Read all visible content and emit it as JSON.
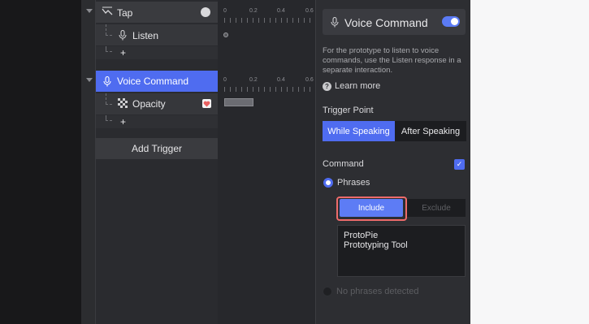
{
  "triggers": [
    {
      "name": "Tap",
      "icon": "tap-gesture-icon",
      "responses": [
        {
          "name": "Listen",
          "icon": "microphone-icon"
        }
      ]
    },
    {
      "name": "Voice Command",
      "icon": "microphone-icon",
      "selected": true,
      "responses": [
        {
          "name": "Opacity",
          "icon": "opacity-checker-icon"
        }
      ]
    }
  ],
  "add_symbol": "+",
  "add_trigger_label": "Add Trigger",
  "timeline": {
    "tick_labels": [
      "0",
      "0.2",
      "0.4",
      "0.6"
    ]
  },
  "panel": {
    "title": "Voice Command",
    "enabled": true,
    "description": "For the prototype to listen to voice commands, use the Listen response in a separate interaction.",
    "learn_more": "Learn more",
    "trigger_point_label": "Trigger Point",
    "trigger_point_options": [
      "While Speaking",
      "After Speaking"
    ],
    "trigger_point_selected": "While Speaking",
    "command_label": "Command",
    "command_checked": true,
    "phrases_label": "Phrases",
    "include_label": "Include",
    "exclude_label": "Exclude",
    "phrases": [
      "ProtoPie",
      "Prototyping Tool"
    ],
    "no_phrases_label": "No phrases detected"
  },
  "colors": {
    "accent": "#4f6cf0",
    "highlight_border": "#ee6b6b",
    "opacity_badge": "#f08a8a"
  }
}
